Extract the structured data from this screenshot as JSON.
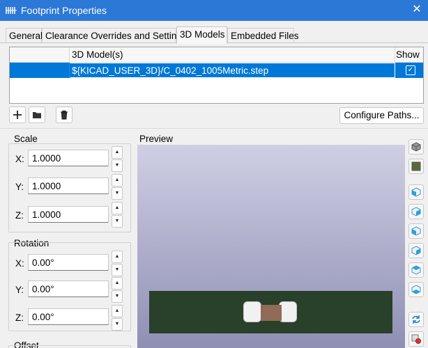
{
  "window": {
    "title": "Footprint Properties",
    "close_glyph": "✕"
  },
  "tabs": [
    {
      "label": "General"
    },
    {
      "label": "Clearance Overrides and Settings"
    },
    {
      "label": "3D Models"
    },
    {
      "label": "Embedded Files"
    }
  ],
  "active_tab": "3D Models",
  "models_table": {
    "columns": [
      "",
      "3D Model(s)",
      "Show"
    ],
    "rows": [
      {
        "path": "${KICAD_USER_3D}/C_0402_1005Metric.step",
        "show": true,
        "selected": true
      }
    ]
  },
  "toolbar": {
    "add_icon": "plus-icon",
    "browse_icon": "folder-icon",
    "delete_icon": "trash-icon",
    "configure_paths_label": "Configure Paths..."
  },
  "scale": {
    "label": "Scale",
    "x_label": "X:",
    "x": "1.0000",
    "y_label": "Y:",
    "y": "1.0000",
    "z_label": "Z:",
    "z": "1.0000"
  },
  "rotation": {
    "label": "Rotation",
    "x_label": "X:",
    "x": "0.00°",
    "y_label": "Y:",
    "y": "0.00°",
    "z_label": "Z:",
    "z": "0.00°"
  },
  "offset": {
    "label": "Offset"
  },
  "preview": {
    "label": "Preview",
    "toolbar_icons": [
      "cube-iso-icon",
      "board-layers-icon",
      "view-left-icon",
      "view-right-icon",
      "view-front-icon",
      "view-back-icon",
      "view-top-icon",
      "view-bottom-icon",
      "reload-icon",
      "settings-icon"
    ]
  },
  "colors": {
    "accent": "#0078d7",
    "titlebar": "#2b78d6",
    "board": "#29402a",
    "component_body": "#8f6b58"
  }
}
